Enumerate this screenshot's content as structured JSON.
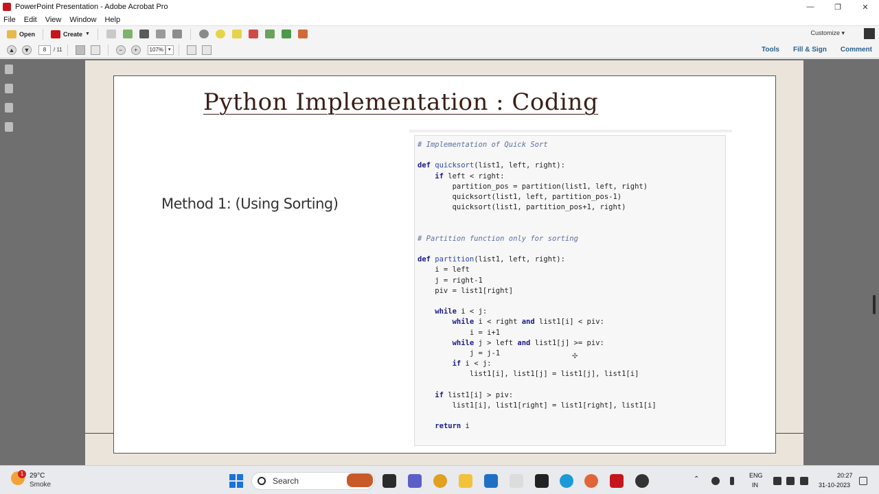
{
  "window": {
    "title": "PowerPoint Presentation - Adobe Acrobat Pro",
    "minimize": "—",
    "restore": "❐",
    "close": "✕"
  },
  "menu": [
    "File",
    "Edit",
    "View",
    "Window",
    "Help"
  ],
  "toolbar": {
    "open_label": "Open",
    "create_label": "Create",
    "customize_label": "Customize"
  },
  "navigation": {
    "current_page": "8",
    "total_pages": "/ 11",
    "zoom": "107%",
    "tools_label": "Tools",
    "fill_sign_label": "Fill & Sign",
    "comment_label": "Comment"
  },
  "slide": {
    "title": "Python Implementation : Coding",
    "method_label": "Method 1: (Using Sorting)",
    "code_lines": [
      "# Implementation of Quick Sort",
      "",
      "def quicksort(list1, left, right):",
      "    if left < right:",
      "        partition_pos = partition(list1, left, right)",
      "        quicksort(list1, left, partition_pos-1)",
      "        quicksort(list1, partition_pos+1, right)",
      "",
      "",
      "# Partition function only for sorting",
      "",
      "def partition(list1, left, right):",
      "    i = left",
      "    j = right-1",
      "    piv = list1[right]",
      "",
      "    while i < j:",
      "        while i < right and list1[i] < piv:",
      "            i = i+1",
      "        while j > left and list1[j] >= piv:",
      "            j = j-1",
      "        if i < j:",
      "            list1[i], list1[j] = list1[j], list1[i]",
      "",
      "    if list1[i] > piv:",
      "        list1[i], list1[right] = list1[right], list1[i]",
      "",
      "    return i"
    ]
  },
  "taskbar": {
    "weather_badge": "1",
    "temperature": "29°C",
    "condition": "Smoke",
    "search_placeholder": "Search",
    "language_top": "ENG",
    "language_bottom": "IN",
    "time": "20:27",
    "date": "31-10-2023"
  }
}
